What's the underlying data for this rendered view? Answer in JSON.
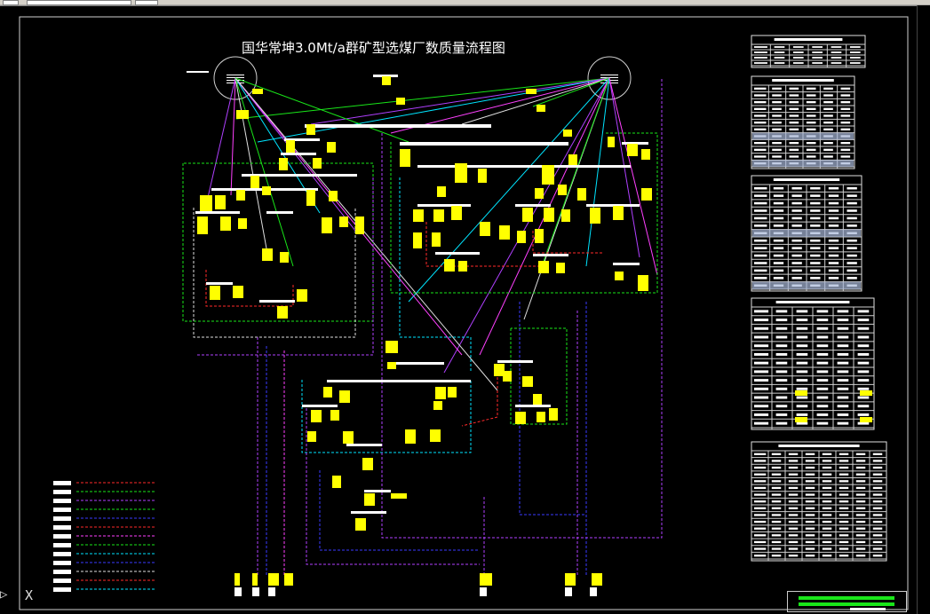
{
  "window": {
    "title": "国华常坤3.0Mt/a群矿型选煤厂数质量流程图"
  },
  "drawing": {
    "background": "#000000",
    "colors": {
      "node_fill": "#ffff00",
      "label_bar": "#ffffff",
      "flow_red": "#ff2a2a",
      "flow_green": "#19e619",
      "flow_purple": "#b040ff",
      "flow_blue": "#3a3aff",
      "flow_cyan": "#00e5ff",
      "flow_magenta": "#ff40ff",
      "flow_white": "#e0e0e0"
    },
    "legend_count": 13,
    "tables_count": 5
  },
  "ucs_icon": "ucs-axis-icon",
  "ucs_label": "X"
}
